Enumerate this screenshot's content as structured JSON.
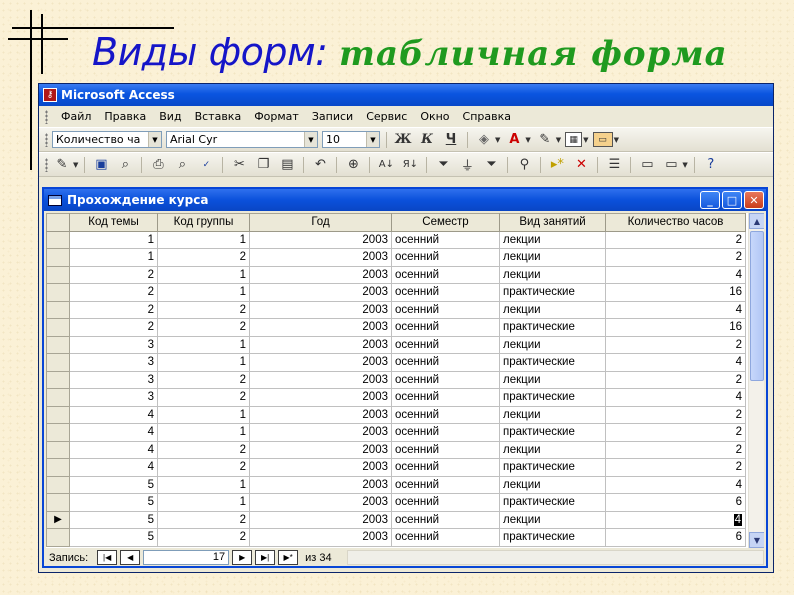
{
  "slide": {
    "title_part1": "Виды форм: ",
    "title_part2": "табличная форма"
  },
  "app": {
    "title": "Microsoft Access",
    "menu": [
      "Файл",
      "Правка",
      "Вид",
      "Вставка",
      "Формат",
      "Записи",
      "Сервис",
      "Окно",
      "Справка"
    ],
    "toolbar": {
      "field_combo": "Количество ча",
      "font_combo": "Arial Cyr",
      "size_combo": "10",
      "bold": "Ж",
      "italic": "К",
      "underline": "Ч"
    }
  },
  "form": {
    "title": "Прохождение курса",
    "columns": [
      "Код темы",
      "Код группы",
      "Год",
      "Семестр",
      "Вид занятий",
      "Количество часов"
    ],
    "rows": [
      [
        "1",
        "1",
        "2003",
        "осенний",
        "лекции",
        "2"
      ],
      [
        "1",
        "2",
        "2003",
        "осенний",
        "лекции",
        "2"
      ],
      [
        "2",
        "1",
        "2003",
        "осенний",
        "лекции",
        "4"
      ],
      [
        "2",
        "1",
        "2003",
        "осенний",
        "практические",
        "16"
      ],
      [
        "2",
        "2",
        "2003",
        "осенний",
        "лекции",
        "4"
      ],
      [
        "2",
        "2",
        "2003",
        "осенний",
        "практические",
        "16"
      ],
      [
        "3",
        "1",
        "2003",
        "осенний",
        "лекции",
        "2"
      ],
      [
        "3",
        "1",
        "2003",
        "осенний",
        "практические",
        "4"
      ],
      [
        "3",
        "2",
        "2003",
        "осенний",
        "лекции",
        "2"
      ],
      [
        "3",
        "2",
        "2003",
        "осенний",
        "практические",
        "4"
      ],
      [
        "4",
        "1",
        "2003",
        "осенний",
        "лекции",
        "2"
      ],
      [
        "4",
        "1",
        "2003",
        "осенний",
        "практические",
        "2"
      ],
      [
        "4",
        "2",
        "2003",
        "осенний",
        "лекции",
        "2"
      ],
      [
        "4",
        "2",
        "2003",
        "осенний",
        "практические",
        "2"
      ],
      [
        "5",
        "1",
        "2003",
        "осенний",
        "лекции",
        "4"
      ],
      [
        "5",
        "1",
        "2003",
        "осенний",
        "практические",
        "6"
      ],
      [
        "5",
        "2",
        "2003",
        "осенний",
        "лекции",
        "4"
      ],
      [
        "5",
        "2",
        "2003",
        "осенний",
        "практические",
        "6"
      ]
    ],
    "current_row_index": 16,
    "navigation": {
      "label": "Запись:",
      "current": "17",
      "of_label": "из",
      "total": "34"
    }
  }
}
